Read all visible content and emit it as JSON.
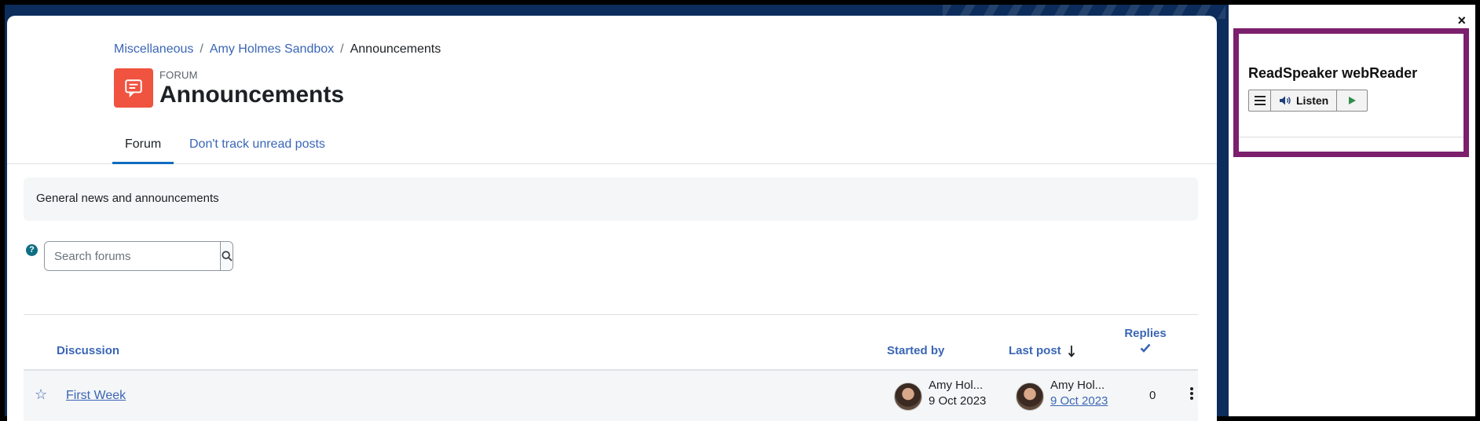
{
  "breadcrumb": {
    "items": [
      "Miscellaneous",
      "Amy Holmes Sandbox",
      "Announcements"
    ],
    "separator": "/"
  },
  "header": {
    "kicker": "FORUM",
    "title": "Announcements"
  },
  "tabs": {
    "forum": "Forum",
    "track": "Don't track unread posts"
  },
  "description": "General news and announcements",
  "search": {
    "placeholder": "Search forums",
    "help": "?"
  },
  "table": {
    "headers": {
      "discussion": "Discussion",
      "started_by": "Started by",
      "last_post": "Last post",
      "replies": "Replies"
    },
    "rows": [
      {
        "topic": "First Week",
        "started_by": "Amy Hol...",
        "started_date": "9 Oct 2023",
        "last_post_by": "Amy Hol...",
        "last_post_date": "9 Oct 2023",
        "replies": "0"
      }
    ]
  },
  "readspeaker": {
    "title": "ReadSpeaker webReader",
    "listen": "Listen",
    "close": "×"
  },
  "colors": {
    "link": "#3a66b6",
    "forum_icon_bg": "#f0533f",
    "panel_border": "#7c1f6d",
    "background": "#0c2d5c"
  }
}
